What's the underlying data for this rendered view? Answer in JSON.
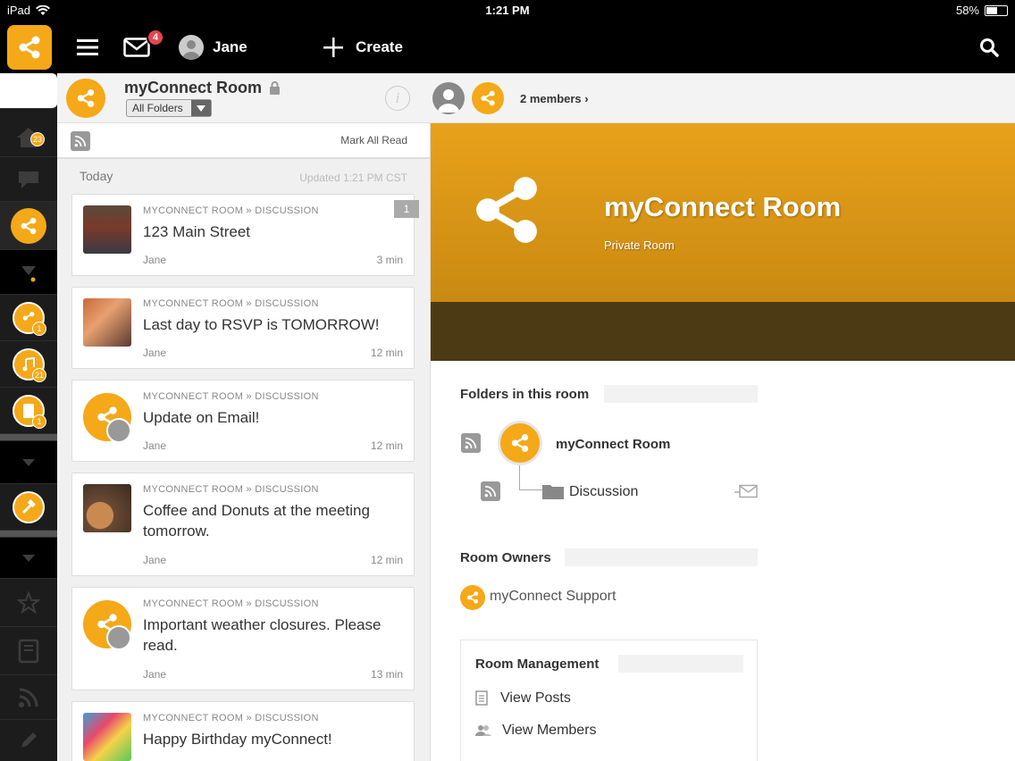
{
  "status_bar": {
    "device": "iPad",
    "time": "1:21 PM",
    "battery": "58%",
    "battery_level": 0.58
  },
  "top_nav": {
    "mail_badge": "4",
    "user_name": "Jane",
    "create_label": "Create"
  },
  "rail": {
    "home_badge": "23",
    "room1_badge": "1",
    "room2_badge": "21",
    "room3_badge": "1"
  },
  "room_header": {
    "title": "myConnect Room",
    "folder_select": "All Folders",
    "members_link": "2 members ›"
  },
  "feed": {
    "mark_all_read": "Mark All Read",
    "day_label": "Today",
    "updated_label": "Updated 1:21 PM CST",
    "items": [
      {
        "crumb": "MYCONNECT ROOM » DISCUSSION",
        "title": "123 Main Street",
        "author": "Jane",
        "time": "3 min",
        "count": "1"
      },
      {
        "crumb": "MYCONNECT ROOM » DISCUSSION",
        "title": "Last day to RSVP is TOMORROW!",
        "author": "Jane",
        "time": "12 min"
      },
      {
        "crumb": "MYCONNECT ROOM » DISCUSSION",
        "title": "Update on Email!",
        "author": "Jane",
        "time": "12 min"
      },
      {
        "crumb": "MYCONNECT ROOM » DISCUSSION",
        "title": "Coffee and Donuts at the meeting tomorrow.",
        "author": "Jane",
        "time": "12 min"
      },
      {
        "crumb": "MYCONNECT ROOM » DISCUSSION",
        "title": "Important weather closures. Please read.",
        "author": "Jane",
        "time": "13 min"
      },
      {
        "crumb": "MYCONNECT ROOM » DISCUSSION",
        "title": "Happy Birthday myConnect!",
        "author": "",
        "time": ""
      }
    ]
  },
  "detail": {
    "hero_title": "myConnect Room",
    "hero_subtitle": "Private Room",
    "folders_title": "Folders in this room",
    "folder_root": "myConnect Room",
    "folder_child": "Discussion",
    "owners_title": "Room Owners",
    "owner_name": "myConnect Support",
    "mgmt_title": "Room Management",
    "mgmt_items": [
      "View Posts",
      "View Members"
    ]
  },
  "colors": {
    "accent": "#f5a818",
    "nav_bg": "#000000",
    "rail_bg": "#1c1c1c",
    "badge": "#e8454e"
  }
}
